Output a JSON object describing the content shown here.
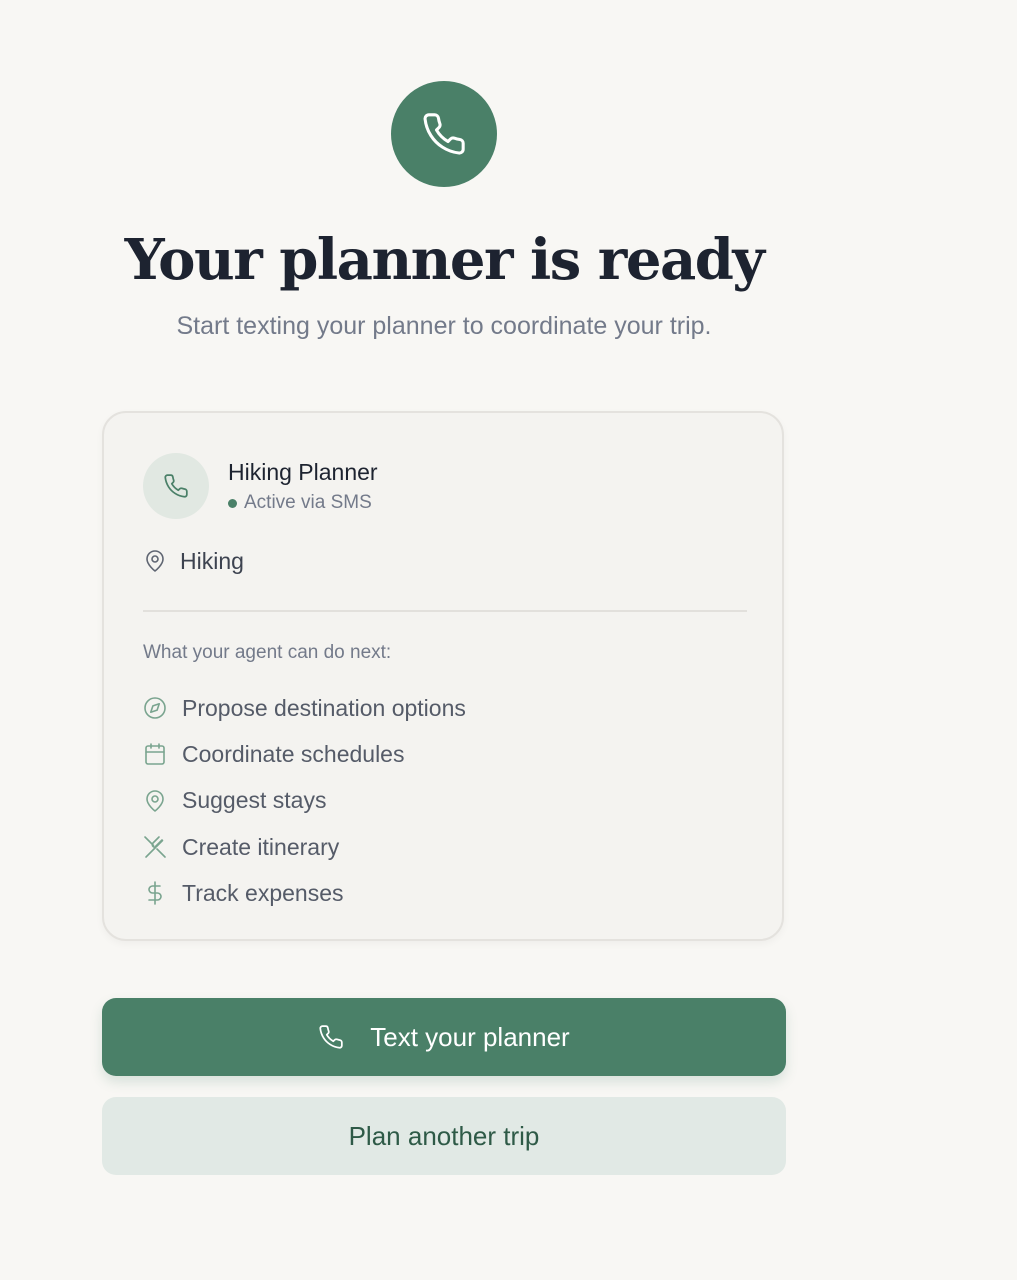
{
  "header": {
    "icon": "phone-icon",
    "title": "Your planner is ready",
    "subtitle": "Start texting your planner to coordinate your trip."
  },
  "card": {
    "avatar_icon": "phone-icon",
    "planner_name": "Hiking Planner",
    "status": "Active via SMS",
    "location_icon": "map-pin-icon",
    "location": "Hiking",
    "next_label": "What your agent can do next:",
    "capabilities": [
      {
        "icon": "compass-icon",
        "label": "Propose destination options"
      },
      {
        "icon": "calendar-icon",
        "label": "Coordinate schedules"
      },
      {
        "icon": "map-pin-icon",
        "label": "Suggest stays"
      },
      {
        "icon": "utensils-icon",
        "label": "Create itinerary"
      },
      {
        "icon": "dollar-icon",
        "label": "Track expenses"
      }
    ]
  },
  "actions": {
    "primary_icon": "phone-icon",
    "primary_label": "Text your planner",
    "secondary_label": "Plan another trip"
  },
  "colors": {
    "accent": "#4a8068",
    "background": "#f8f7f4",
    "card_background": "#f4f3f0",
    "secondary_button": "#e1e9e5",
    "heading": "#1d2330",
    "muted_text": "#737a8a"
  }
}
